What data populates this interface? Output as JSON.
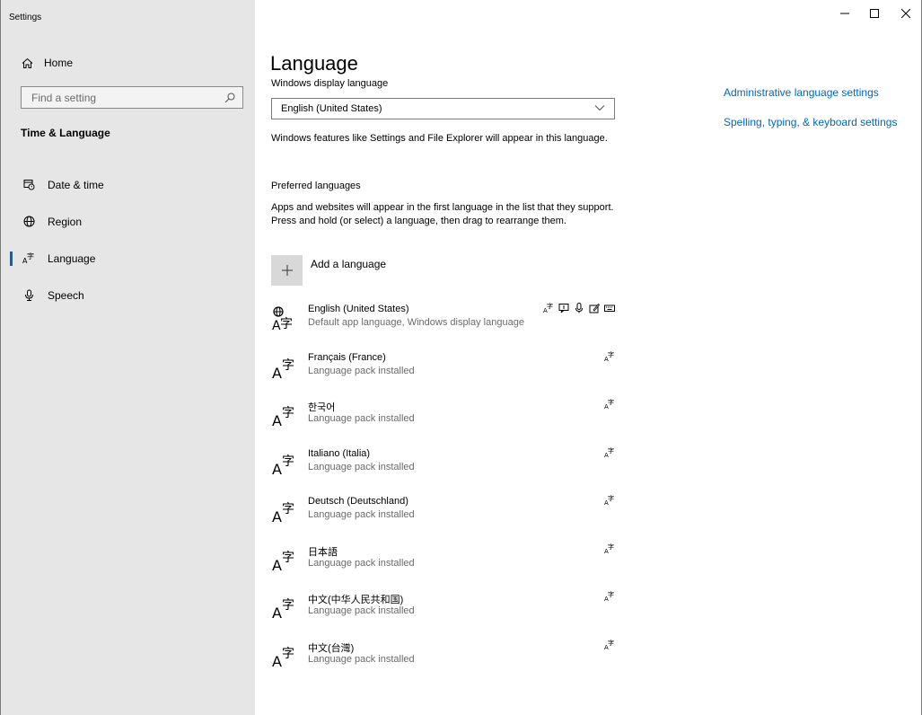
{
  "app": {
    "title": "Settings"
  },
  "window_controls": {
    "minimize": "—",
    "maximize": "☐",
    "close": "✕"
  },
  "sidebar": {
    "home_label": "Home",
    "search_placeholder": "Find a setting",
    "section_title": "Time & Language",
    "items": [
      {
        "label": "Date & time",
        "icon": "calendar-clock-icon",
        "active": false
      },
      {
        "label": "Region",
        "icon": "globe-icon",
        "active": false
      },
      {
        "label": "Language",
        "icon": "language-icon",
        "active": true
      },
      {
        "label": "Speech",
        "icon": "microphone-icon",
        "active": false
      }
    ]
  },
  "main": {
    "title": "Language",
    "display_language_label": "Windows display language",
    "display_language_value": "English (United States)",
    "display_language_desc": "Windows features like Settings and File Explorer will appear in this language.",
    "preferred_label": "Preferred languages",
    "preferred_desc": "Apps and websites will appear in the first language in the list that they support. Press and hold (or select) a language, then drag to rearrange them.",
    "add_language_label": "Add a language",
    "languages": [
      {
        "name": "English (United States)",
        "status": "Default app language, Windows display language"
      },
      {
        "name": "Français (France)",
        "status": "Language pack installed"
      },
      {
        "name": "한국어",
        "status": "Language pack installed"
      },
      {
        "name": "Italiano (Italia)",
        "status": "Language pack installed"
      },
      {
        "name": "Deutsch (Deutschland)",
        "status": "Language pack installed"
      },
      {
        "name": "日本語",
        "status": "Language pack installed"
      },
      {
        "name": "中文(中华人民共和国)",
        "status": "Language pack installed"
      },
      {
        "name": "中文(台灣)",
        "status": "Language pack installed"
      }
    ]
  },
  "related": {
    "admin_link": "Administrative language settings",
    "spelling_link": "Spelling, typing, & keyboard settings"
  },
  "colors": {
    "accent": "#0067c0",
    "sidebar_bg": "#e6e6e6"
  }
}
